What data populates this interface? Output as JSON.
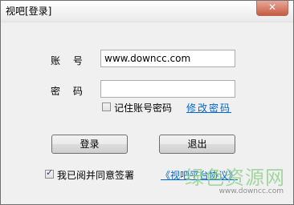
{
  "window": {
    "title": "视吧[登录]",
    "close_label": "✕"
  },
  "form": {
    "account_label": "账 号",
    "account_value": "www.downcc.com",
    "password_label": "密 码",
    "password_value": "",
    "remember_label": "记住账号密码",
    "remember_checked": false,
    "change_password_link": "修改密码"
  },
  "buttons": {
    "login_label": "登录",
    "exit_label": "退出"
  },
  "agreement": {
    "checked": true,
    "label": "我已阅并同意签署",
    "link": "《视吧平台协议》"
  },
  "watermark": {
    "text": "绿色资源网",
    "url": "www.downcc.com"
  }
}
